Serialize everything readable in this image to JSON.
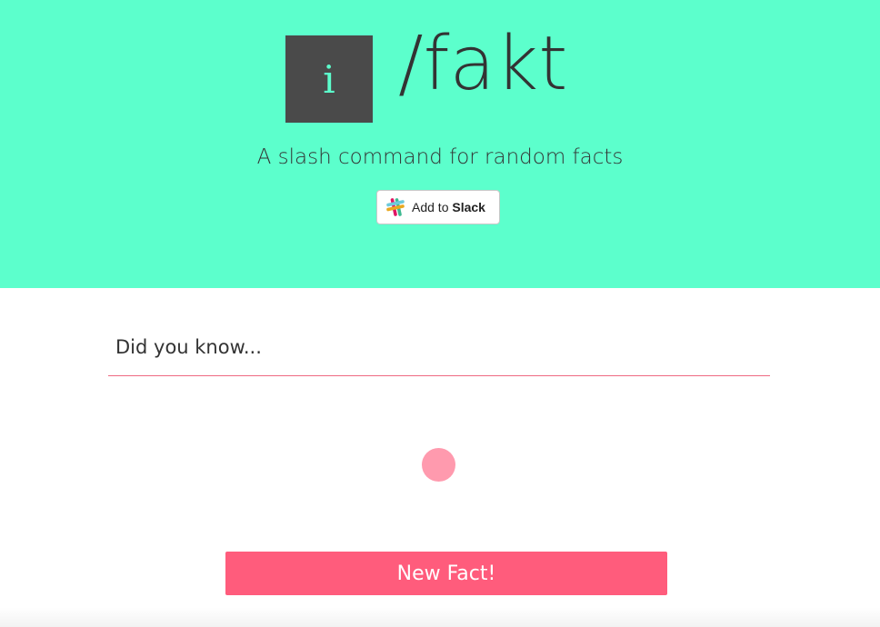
{
  "hero": {
    "logo_glyph": "i",
    "brand": "/fakt",
    "tagline": "A slash command for random facts",
    "slack_button": {
      "prefix": "Add to ",
      "bold": "Slack",
      "icon": "slack-icon"
    },
    "background": "#5cffcc"
  },
  "main": {
    "fact_heading": "Did you know...",
    "new_fact_label": "New Fact!",
    "loading_indicator": "spinner"
  },
  "colors": {
    "accent": "#ff5c7c",
    "underline": "#ef6a82",
    "logo_box": "#4a4a4a",
    "text": "#333333"
  }
}
